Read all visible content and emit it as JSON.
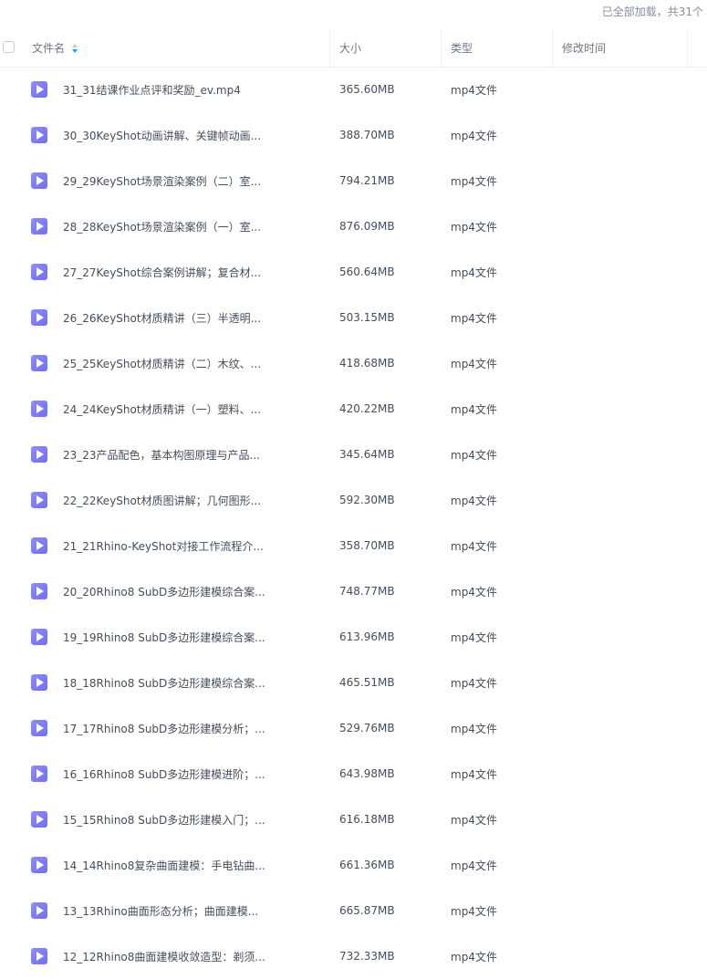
{
  "status_text": "已全部加载，共31个",
  "columns": {
    "name": "文件名",
    "size": "大小",
    "type": "类型",
    "modified": "修改时间"
  },
  "files": [
    {
      "name": "31_31结课作业点评和奖励_ev.mp4",
      "size": "365.60MB",
      "type": "mp4文件",
      "modified": ""
    },
    {
      "name": "30_30KeyShot动画讲解、关键帧动画...",
      "size": "388.70MB",
      "type": "mp4文件",
      "modified": ""
    },
    {
      "name": "29_29KeyShot场景渲染案例（二）室...",
      "size": "794.21MB",
      "type": "mp4文件",
      "modified": ""
    },
    {
      "name": "28_28KeyShot场景渲染案例（一）室...",
      "size": "876.09MB",
      "type": "mp4文件",
      "modified": ""
    },
    {
      "name": "27_27KeyShot综合案例讲解；复合材...",
      "size": "560.64MB",
      "type": "mp4文件",
      "modified": ""
    },
    {
      "name": "26_26KeyShot材质精讲（三）半透明...",
      "size": "503.15MB",
      "type": "mp4文件",
      "modified": ""
    },
    {
      "name": "25_25KeyShot材质精讲（二）木纹、...",
      "size": "418.68MB",
      "type": "mp4文件",
      "modified": ""
    },
    {
      "name": "24_24KeyShot材质精讲（一）塑料、...",
      "size": "420.22MB",
      "type": "mp4文件",
      "modified": ""
    },
    {
      "name": "23_23产品配色，基本构图原理与产品...",
      "size": "345.64MB",
      "type": "mp4文件",
      "modified": ""
    },
    {
      "name": "22_22KeyShot材质图讲解；几何图形...",
      "size": "592.30MB",
      "type": "mp4文件",
      "modified": ""
    },
    {
      "name": "21_21Rhino-KeyShot对接工作流程介...",
      "size": "358.70MB",
      "type": "mp4文件",
      "modified": ""
    },
    {
      "name": "20_20Rhino8 SubD多边形建模综合案...",
      "size": "748.77MB",
      "type": "mp4文件",
      "modified": ""
    },
    {
      "name": "19_19Rhino8 SubD多边形建模综合案...",
      "size": "613.96MB",
      "type": "mp4文件",
      "modified": ""
    },
    {
      "name": "18_18Rhino8 SubD多边形建模综合案...",
      "size": "465.51MB",
      "type": "mp4文件",
      "modified": ""
    },
    {
      "name": "17_17Rhino8 SubD多边形建模分析；...",
      "size": "529.76MB",
      "type": "mp4文件",
      "modified": ""
    },
    {
      "name": "16_16Rhino8 SubD多边形建模进阶；...",
      "size": "643.98MB",
      "type": "mp4文件",
      "modified": ""
    },
    {
      "name": "15_15Rhino8 SubD多边形建模入门；...",
      "size": "616.18MB",
      "type": "mp4文件",
      "modified": ""
    },
    {
      "name": "14_14Rhino8复杂曲面建模：手电钻曲...",
      "size": "661.36MB",
      "type": "mp4文件",
      "modified": ""
    },
    {
      "name": "13_13Rhino曲面形态分析；曲面建模...",
      "size": "665.87MB",
      "type": "mp4文件",
      "modified": ""
    },
    {
      "name": "12_12Rhino8曲面建模收敛造型：剃须...",
      "size": "732.33MB",
      "type": "mp4文件",
      "modified": ""
    }
  ],
  "icons": {
    "file": "video-file-icon",
    "sort": "sort-icon",
    "select_all": "checkbox"
  },
  "colors": {
    "file_icon": "#7b79f7",
    "sort_active": "#06a7ff"
  }
}
